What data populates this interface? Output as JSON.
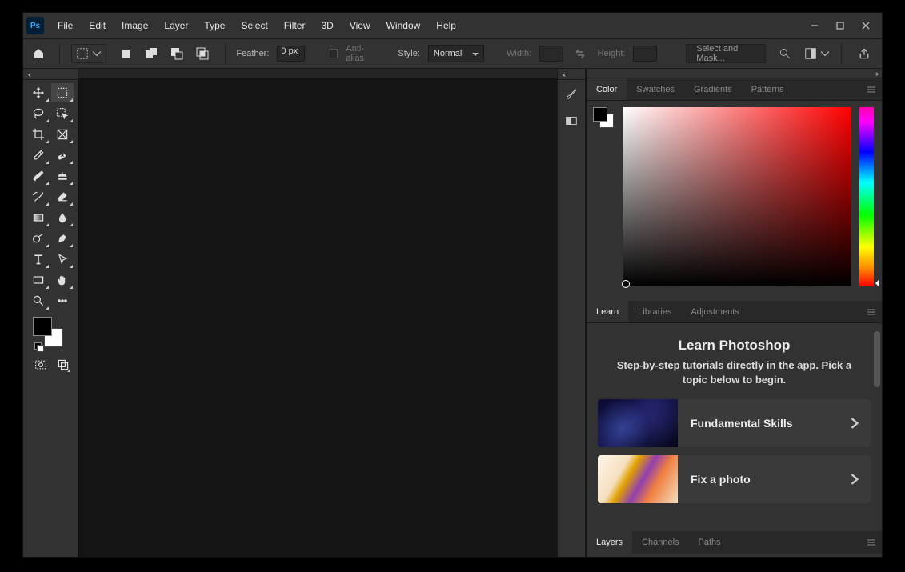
{
  "menu": {
    "items": [
      "File",
      "Edit",
      "Image",
      "Layer",
      "Type",
      "Select",
      "Filter",
      "3D",
      "View",
      "Window",
      "Help"
    ]
  },
  "options": {
    "feather_label": "Feather:",
    "feather_value": "0 px",
    "antialias_label": "Anti-alias",
    "style_label": "Style:",
    "style_value": "Normal",
    "width_label": "Width:",
    "width_value": "",
    "height_label": "Height:",
    "height_value": "",
    "select_mask_label": "Select and Mask..."
  },
  "panels": {
    "color": {
      "tabs": [
        "Color",
        "Swatches",
        "Gradients",
        "Patterns"
      ],
      "active": 0,
      "fg": "#000000",
      "bg": "#ffffff"
    },
    "learn": {
      "tabs": [
        "Learn",
        "Libraries",
        "Adjustments"
      ],
      "active": 0,
      "title": "Learn Photoshop",
      "subtitle": "Step-by-step tutorials directly in the app. Pick a topic below to begin.",
      "tutorials": [
        {
          "label": "Fundamental Skills",
          "thumb": "dark"
        },
        {
          "label": "Fix a photo",
          "thumb": "flowers"
        }
      ]
    },
    "layers": {
      "tabs": [
        "Layers",
        "Channels",
        "Paths"
      ],
      "active": 0
    }
  }
}
